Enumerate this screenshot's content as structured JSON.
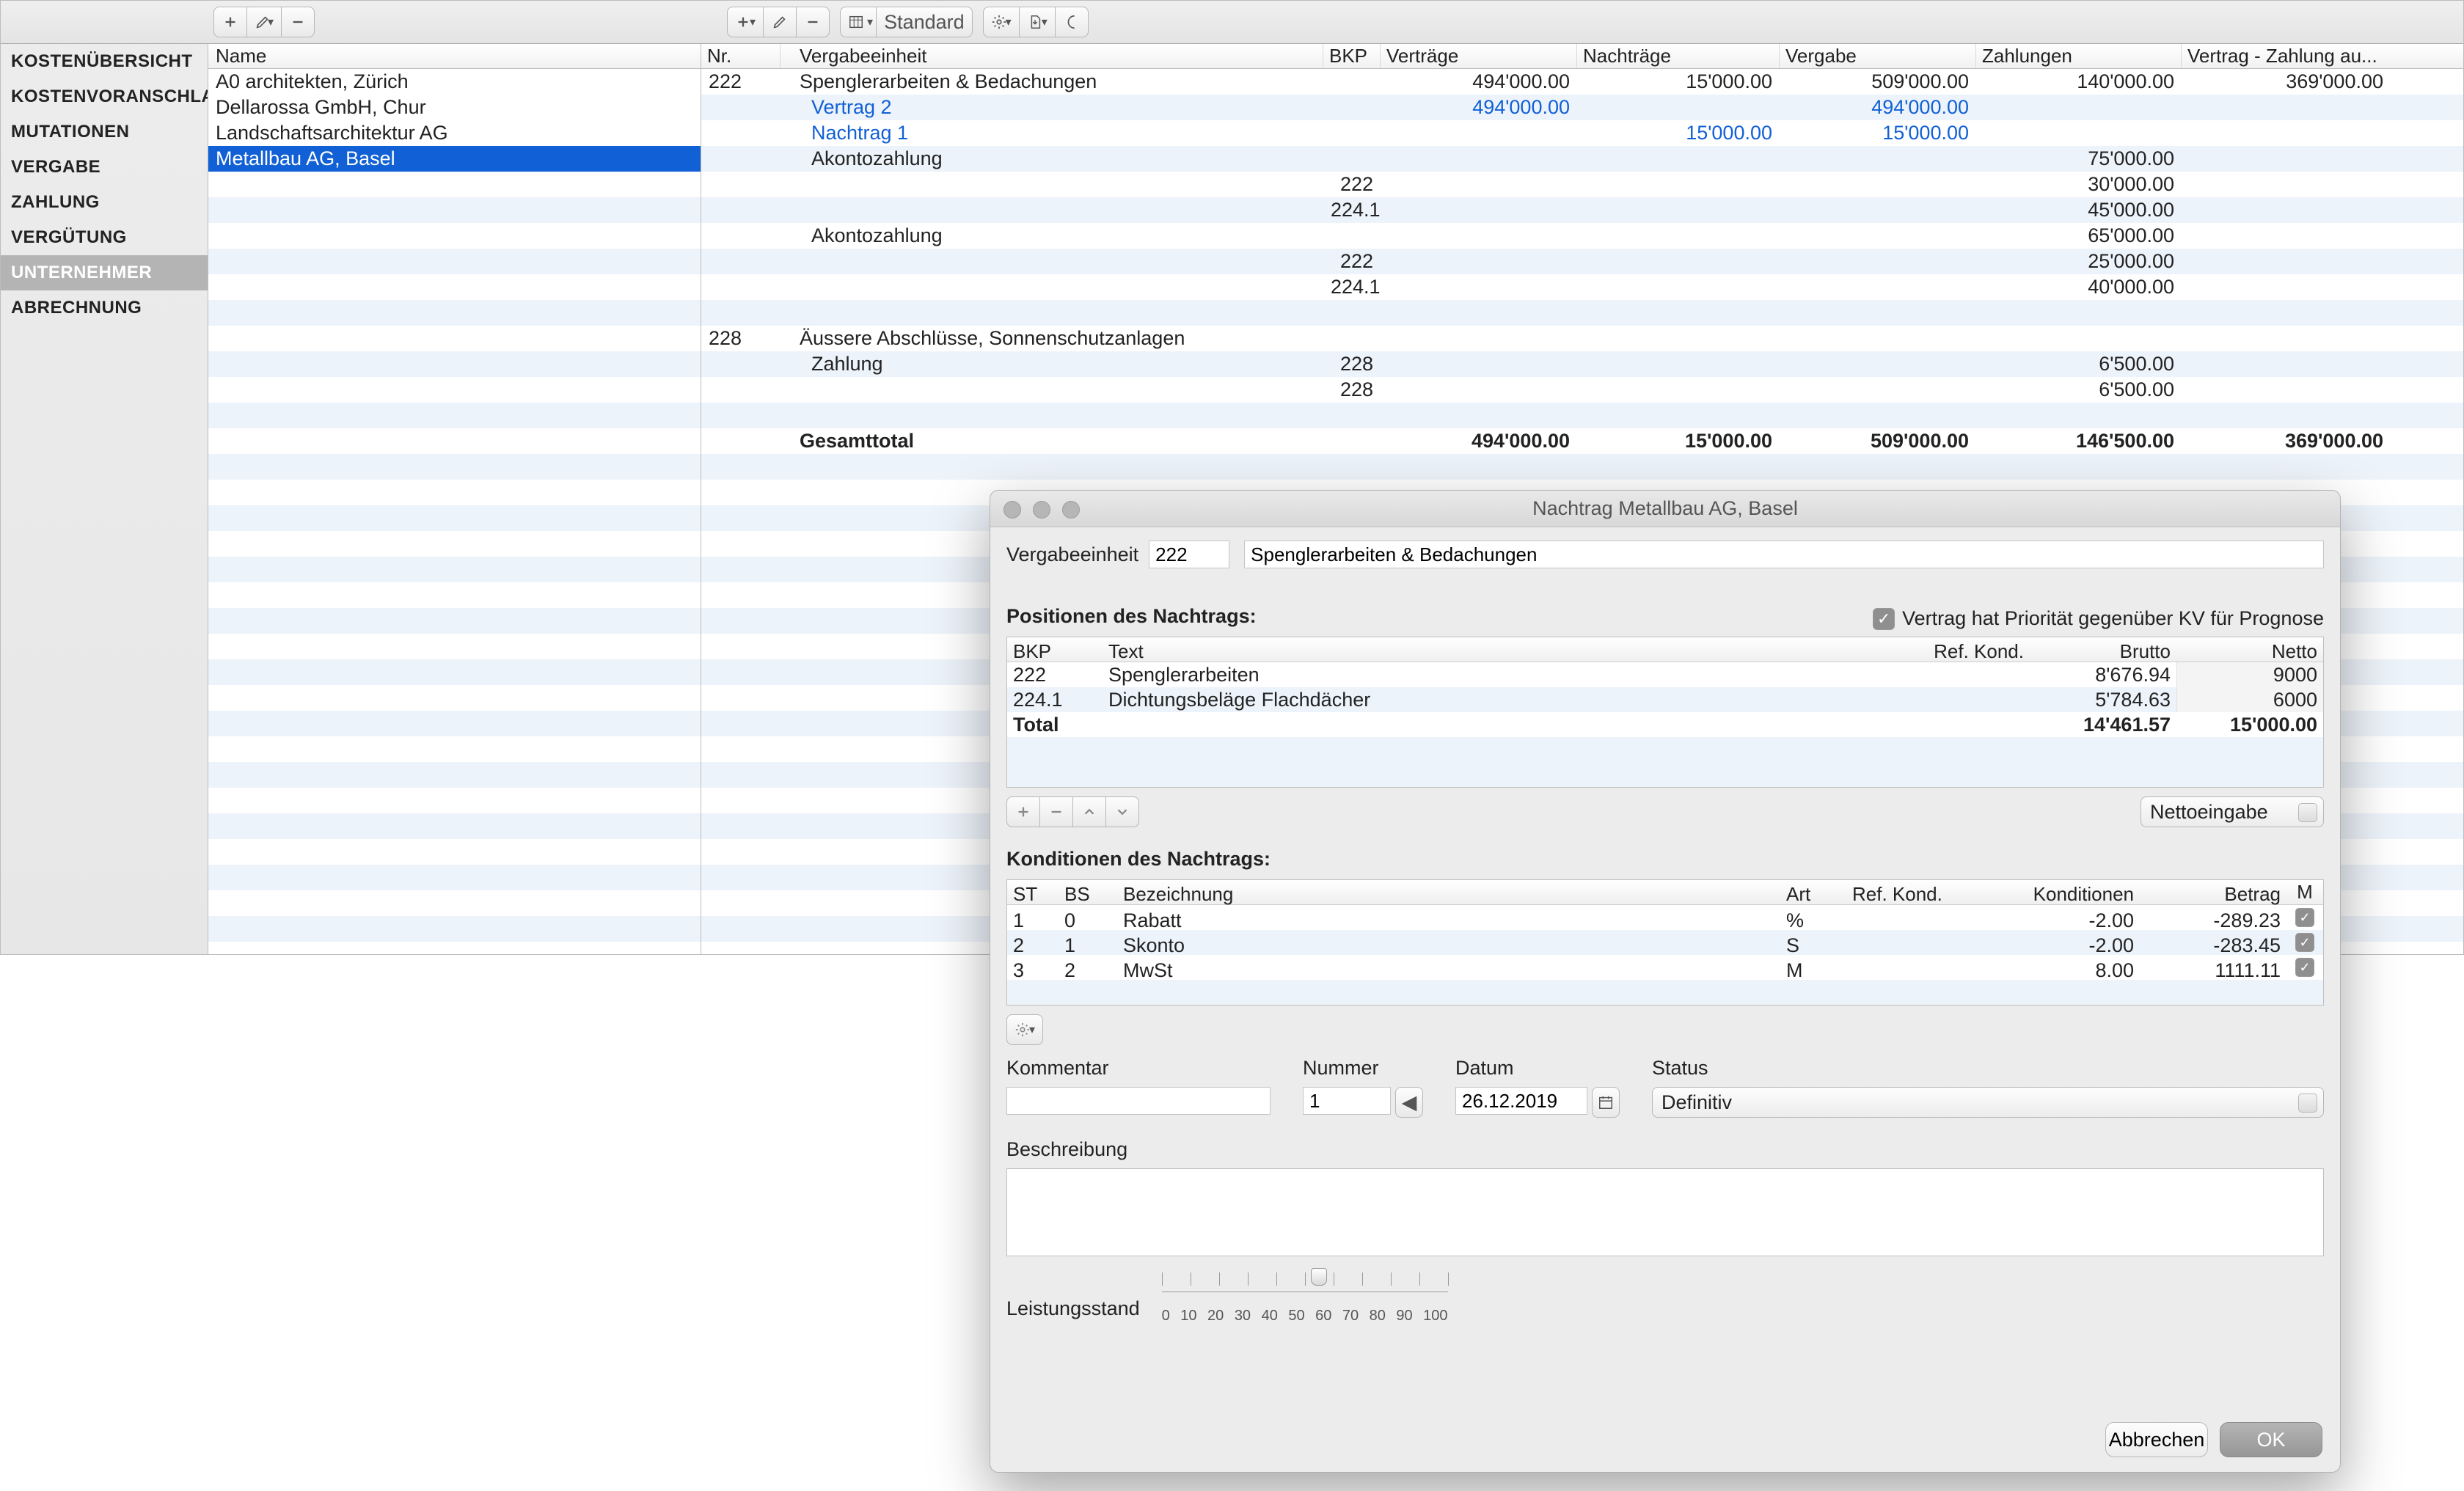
{
  "toolbar": {
    "view_label": "Standard"
  },
  "sidebar": {
    "items": [
      {
        "label": "KOSTENÜBERSICHT"
      },
      {
        "label": "KOSTENVORANSCHLAG"
      },
      {
        "label": "MUTATIONEN"
      },
      {
        "label": "VERGABE"
      },
      {
        "label": "ZAHLUNG"
      },
      {
        "label": "VERGÜTUNG"
      },
      {
        "label": "UNTERNEHMER"
      },
      {
        "label": "ABRECHNUNG"
      }
    ],
    "selected": 6
  },
  "namelist": {
    "header": "Name",
    "items": [
      "A0 architekten, Zürich",
      "Dellarossa GmbH, Chur",
      "Landschaftsarchitektur AG",
      "Metallbau AG, Basel"
    ],
    "selected": 3
  },
  "grid": {
    "headers": {
      "nr": "Nr.",
      "ve": "Vergabeeinheit",
      "bkp": "BKP",
      "vt": "Verträge",
      "nt": "Nachträge",
      "vg": "Vergabe",
      "zl": "Zahlungen",
      "vz": "Vertrag - Zahlung au..."
    },
    "rows": [
      {
        "nr": "222",
        "ve": "Spenglerarbeiten & Bedachungen",
        "bkp": "",
        "vt": "494'000.00",
        "nt": "15'000.00",
        "vg": "509'000.00",
        "zl": "140'000.00",
        "vz": "369'000.00"
      },
      {
        "nr": "",
        "ve": "Vertrag 2",
        "bkp": "",
        "vt": "494'000.00",
        "nt": "",
        "vg": "494'000.00",
        "zl": "",
        "vz": "",
        "hl": true,
        "indent": true
      },
      {
        "nr": "",
        "ve": "Nachtrag 1",
        "bkp": "",
        "vt": "",
        "nt": "15'000.00",
        "vg": "15'000.00",
        "zl": "",
        "vz": "",
        "hl": true,
        "indent": true
      },
      {
        "nr": "",
        "ve": "Akontozahlung",
        "bkp": "",
        "vt": "",
        "nt": "",
        "vg": "",
        "zl": "75'000.00",
        "vz": "",
        "indent": true
      },
      {
        "nr": "",
        "ve": "",
        "bkp": "222",
        "vt": "",
        "nt": "",
        "vg": "",
        "zl": "30'000.00",
        "vz": ""
      },
      {
        "nr": "",
        "ve": "",
        "bkp": "224.1",
        "vt": "",
        "nt": "",
        "vg": "",
        "zl": "45'000.00",
        "vz": ""
      },
      {
        "nr": "",
        "ve": "Akontozahlung",
        "bkp": "",
        "vt": "",
        "nt": "",
        "vg": "",
        "zl": "65'000.00",
        "vz": "",
        "indent": true
      },
      {
        "nr": "",
        "ve": "",
        "bkp": "222",
        "vt": "",
        "nt": "",
        "vg": "",
        "zl": "25'000.00",
        "vz": ""
      },
      {
        "nr": "",
        "ve": "",
        "bkp": "224.1",
        "vt": "",
        "nt": "",
        "vg": "",
        "zl": "40'000.00",
        "vz": ""
      },
      {
        "nr": "",
        "ve": "",
        "bkp": "",
        "vt": "",
        "nt": "",
        "vg": "",
        "zl": "",
        "vz": ""
      },
      {
        "nr": "228",
        "ve": "Äussere Abschlüsse, Sonnenschutzanlagen",
        "bkp": "",
        "vt": "",
        "nt": "",
        "vg": "",
        "zl": "",
        "vz": ""
      },
      {
        "nr": "",
        "ve": "Zahlung",
        "bkp": "228",
        "vt": "",
        "nt": "",
        "vg": "",
        "zl": "6'500.00",
        "vz": "",
        "indent": true
      },
      {
        "nr": "",
        "ve": "",
        "bkp": "228",
        "vt": "",
        "nt": "",
        "vg": "",
        "zl": "6'500.00",
        "vz": ""
      },
      {
        "nr": "",
        "ve": "",
        "bkp": "",
        "vt": "",
        "nt": "",
        "vg": "",
        "zl": "",
        "vz": ""
      },
      {
        "nr": "",
        "ve": "Gesamttotal",
        "bkp": "",
        "vt": "494'000.00",
        "nt": "15'000.00",
        "vg": "509'000.00",
        "zl": "146'500.00",
        "vz": "369'000.00",
        "bold": true
      }
    ],
    "filler": 20
  },
  "dialog": {
    "title": "Nachtrag Metallbau AG, Basel",
    "ve_label": "Vergabeeinheit",
    "ve_nr": "222",
    "ve_name": "Spenglerarbeiten & Bedachungen",
    "pos_title": "Positionen des Nachtrags:",
    "prio_label": "Vertrag hat Priorität gegenüber KV für Prognose",
    "pos_headers": {
      "bkp": "BKP",
      "text": "Text",
      "rk": "Ref. Kond.",
      "br": "Brutto",
      "nt": "Netto"
    },
    "pos_rows": [
      {
        "bkp": "222",
        "text": "Spenglerarbeiten",
        "rk": "",
        "br": "8'676.94",
        "nt": "9000"
      },
      {
        "bkp": "224.1",
        "text": "Dichtungsbeläge Flachdächer",
        "rk": "",
        "br": "5'784.63",
        "nt": "6000"
      },
      {
        "bkp": "Total",
        "text": "",
        "rk": "",
        "br": "14'461.57",
        "nt": "15'000.00",
        "bold": true
      }
    ],
    "netto_select": "Nettoeingabe",
    "kond_title": "Konditionen des Nachtrags:",
    "kond_headers": {
      "st": "ST",
      "bs": "BS",
      "bz": "Bezeichnung",
      "art": "Art",
      "rk": "Ref. Kond.",
      "kd": "Konditionen",
      "bt": "Betrag",
      "m": "M"
    },
    "kond_rows": [
      {
        "st": "1",
        "bs": "0",
        "bz": "Rabatt",
        "art": "%",
        "rk": "",
        "kd": "-2.00",
        "bt": "-289.23"
      },
      {
        "st": "2",
        "bs": "1",
        "bz": "Skonto",
        "art": "S",
        "rk": "",
        "kd": "-2.00",
        "bt": "-283.45"
      },
      {
        "st": "3",
        "bs": "2",
        "bz": "MwSt",
        "art": "M",
        "rk": "",
        "kd": "8.00",
        "bt": "1111.11"
      }
    ],
    "kommentar_label": "Kommentar",
    "kommentar": "",
    "nummer_label": "Nummer",
    "nummer": "1",
    "datum_label": "Datum",
    "datum": "26.12.2019",
    "status_label": "Status",
    "status": "Definitiv",
    "beschreibung_label": "Beschreibung",
    "beschreibung": "",
    "leistung_label": "Leistungsstand",
    "tick_values": [
      "0",
      "10",
      "20",
      "30",
      "40",
      "50",
      "60",
      "70",
      "80",
      "90",
      "100"
    ],
    "leistung_value": 55,
    "cancel": "Abbrechen",
    "ok": "OK"
  }
}
